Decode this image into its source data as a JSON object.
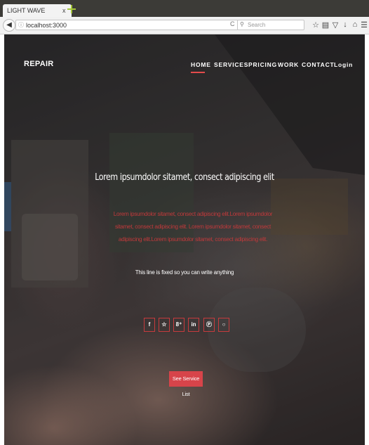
{
  "browser": {
    "tab_title": "LIGHT WAVE",
    "tab_close": "x",
    "url": "localhost:3000",
    "search_placeholder": "Search",
    "reload_glyph": "C"
  },
  "site": {
    "brand": "REPAIR",
    "nav": [
      "HOME",
      "SERVICES",
      "PRICING",
      "WORK",
      "CONTACT",
      "Login"
    ],
    "active_nav": "HOME",
    "accent_color": "#d7444a",
    "headline": "Lorem ipsumdolor sitamet, consect adipiscing elit",
    "description": "Lorem ipsumdolor sitamet, consect adipiscing elit.Lorem ipsumdolor sitamet, consect adipiscing elit. Lorem ipsumdolor sitamet, consect adipiscing elit.Lorem ipsumdolor sitamet, consect adipiscing elit.",
    "fixed_line": "This line is fixed so you can write anything",
    "social": [
      {
        "name": "facebook-icon",
        "glyph": "f"
      },
      {
        "name": "twitter-icon",
        "glyph": "☆"
      },
      {
        "name": "google-plus-icon",
        "glyph": "8⁺"
      },
      {
        "name": "linkedin-icon",
        "glyph": "in"
      },
      {
        "name": "pinterest-icon",
        "glyph": "Ⓟ"
      },
      {
        "name": "github-icon",
        "glyph": "○"
      }
    ],
    "cta_label": "See Service List"
  }
}
